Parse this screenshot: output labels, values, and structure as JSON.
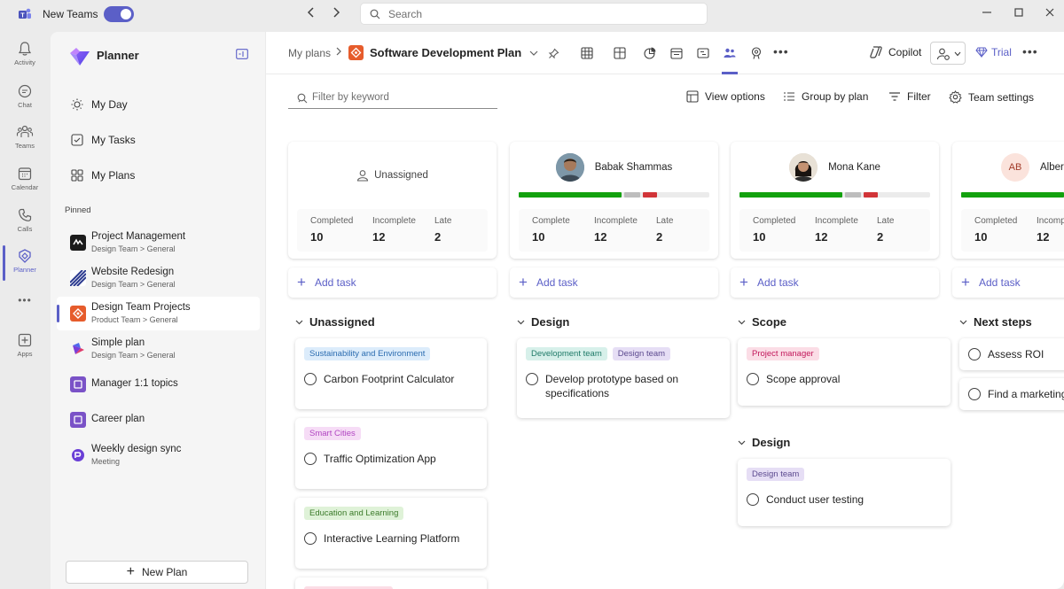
{
  "titlebar": {
    "app_name": "New Teams",
    "search_placeholder": "Search",
    "back_icon": "chevron-left-icon",
    "forward_icon": "chevron-right-icon"
  },
  "rail": {
    "items": [
      {
        "label": "Activity",
        "icon": "bell-icon"
      },
      {
        "label": "Chat",
        "icon": "chat-icon"
      },
      {
        "label": "Teams",
        "icon": "teams-icon"
      },
      {
        "label": "Calendar",
        "icon": "calendar-icon"
      },
      {
        "label": "Calls",
        "icon": "phone-icon"
      },
      {
        "label": "Planner",
        "icon": "planner-icon"
      },
      {
        "label": "Apps",
        "icon": "plus-square-icon"
      }
    ],
    "more_label": "•••"
  },
  "sidebar": {
    "title": "Planner",
    "nav": [
      {
        "label": "My Day"
      },
      {
        "label": "My Tasks"
      },
      {
        "label": "My Plans"
      }
    ],
    "pinned_label": "Pinned",
    "pinned": [
      {
        "title": "Project Management",
        "subtitle": "Design Team > General"
      },
      {
        "title": "Website Redesign",
        "subtitle": "Design Team > General"
      },
      {
        "title": "Design Team Projects",
        "subtitle": "Product Team > General"
      },
      {
        "title": "Simple plan",
        "subtitle": "Design Team > General"
      },
      {
        "title": "Manager 1:1 topics",
        "subtitle": ""
      },
      {
        "title": "Career plan",
        "subtitle": ""
      },
      {
        "title": "Weekly design sync",
        "subtitle": "Meeting"
      }
    ],
    "new_plan_label": "New Plan"
  },
  "header": {
    "breadcrumb": "My plans",
    "plan_name": "Software Development Plan",
    "copilot_label": "Copilot",
    "trial_label": "Trial",
    "more_label": "•••"
  },
  "toolbar": {
    "filter_placeholder": "Filter by keyword",
    "view_options": "View options",
    "group_by": "Group by plan",
    "filter": "Filter",
    "team_settings": "Team settings"
  },
  "colors": {
    "accent": "#5b5fc7",
    "complete": "#13a10e",
    "late": "#d13438",
    "incomplete": "#bdbdbd"
  },
  "columns": [
    {
      "name": "Unassigned",
      "avatar": "person-outline-icon",
      "stats": [
        {
          "label": "Completed",
          "value": "10"
        },
        {
          "label": "Incomplete",
          "value": "12"
        },
        {
          "label": "Late",
          "value": "2"
        }
      ],
      "add_task": "Add task",
      "buckets": [
        {
          "name": "Unassigned",
          "cards": [
            {
              "tags": [
                {
                  "text": "Sustainability and Environment",
                  "bg": "#dcecfb",
                  "fg": "#2b6cb0"
                }
              ],
              "task": "Carbon Footprint Calculator"
            },
            {
              "tags": [
                {
                  "text": "Smart Cities",
                  "bg": "#f6dcf6",
                  "fg": "#b146c2"
                }
              ],
              "task": "Traffic Optimization App"
            },
            {
              "tags": [
                {
                  "text": "Education and Learning",
                  "bg": "#dff2d8",
                  "fg": "#3b7a2a"
                }
              ],
              "task": "Interactive Learning Platform"
            }
          ]
        }
      ]
    },
    {
      "name": "Babak Shammas",
      "stats": [
        {
          "label": "Complete",
          "value": "10"
        },
        {
          "label": "Incomplete",
          "value": "12"
        },
        {
          "label": "Late",
          "value": "2"
        }
      ],
      "add_task": "Add task",
      "buckets": [
        {
          "name": "Design",
          "cards": [
            {
              "tags": [
                {
                  "text": "Development team",
                  "bg": "#d7f0ea",
                  "fg": "#1f7a68"
                },
                {
                  "text": "Design team",
                  "bg": "#e6def5",
                  "fg": "#5c4a8f"
                }
              ],
              "task": "Develop prototype based on specifications"
            }
          ]
        }
      ]
    },
    {
      "name": "Mona Kane",
      "stats": [
        {
          "label": "Completed",
          "value": "10"
        },
        {
          "label": "Incomplete",
          "value": "12"
        },
        {
          "label": "Late",
          "value": "2"
        }
      ],
      "add_task": "Add task",
      "buckets": [
        {
          "name": "Scope",
          "cards": [
            {
              "tags": [
                {
                  "text": "Project manager",
                  "bg": "#fbdde6",
                  "fg": "#c2185b"
                }
              ],
              "task": "Scope approval"
            }
          ]
        },
        {
          "name": "Design",
          "cards": [
            {
              "tags": [
                {
                  "text": "Design team",
                  "bg": "#e6def5",
                  "fg": "#5c4a8f"
                }
              ],
              "task": "Conduct user testing"
            }
          ]
        }
      ]
    },
    {
      "name": "Albert",
      "initials": "AB",
      "stats": [
        {
          "label": "Completed",
          "value": "10"
        },
        {
          "label": "Incomp",
          "value": "12"
        }
      ],
      "add_task": "Add task",
      "buckets": [
        {
          "name": "Next steps",
          "cards": [
            {
              "tags": [],
              "task": "Assess ROI"
            },
            {
              "tags": [],
              "task": "Find a marketing"
            }
          ]
        }
      ]
    }
  ]
}
